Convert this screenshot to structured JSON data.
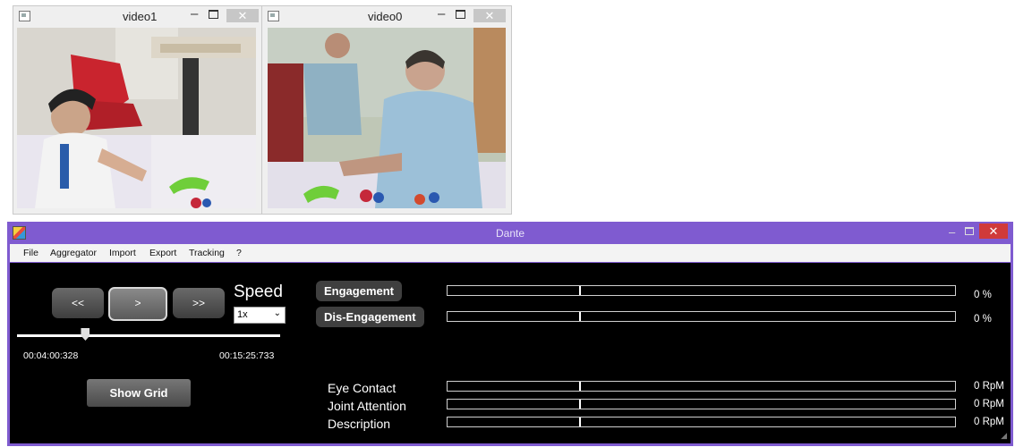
{
  "video_windows": [
    {
      "title": "video1",
      "min": "–",
      "close": "✕"
    },
    {
      "title": "video0",
      "min": "–",
      "close": "✕"
    }
  ],
  "app": {
    "title": "Dante",
    "min": "–",
    "close": "✕"
  },
  "menu": [
    "File",
    "Aggregator",
    "Import",
    "Export",
    "Tracking",
    "?"
  ],
  "player": {
    "rewind_label": "<<",
    "play_label": ">",
    "forward_label": ">>",
    "speed_label": "Speed",
    "speed_value": "1x",
    "current_time": "00:04:00:328",
    "total_time": "00:15:25:733",
    "position_fraction": 0.26,
    "show_grid_label": "Show Grid"
  },
  "measures": {
    "engagement": {
      "label": "Engagement",
      "value_text": "0 %",
      "value": 0,
      "marker_fraction": 0.26
    },
    "disengagement": {
      "label": "Dis-Engagement",
      "value_text": "0 %",
      "value": 0,
      "marker_fraction": 0.26
    },
    "eye_contact": {
      "label": "Eye Contact",
      "value_text": "0 RpM",
      "value": 0,
      "marker_fraction": 0.26
    },
    "joint_attention": {
      "label": "Joint Attention",
      "value_text": "0 RpM",
      "value": 0,
      "marker_fraction": 0.26
    },
    "description": {
      "label": "Description",
      "value_text": "0 RpM",
      "value": 0,
      "marker_fraction": 0.26
    }
  },
  "colors": {
    "titlebar": "#7f5bd0",
    "close": "#d03a3a",
    "panel": "#000000"
  }
}
